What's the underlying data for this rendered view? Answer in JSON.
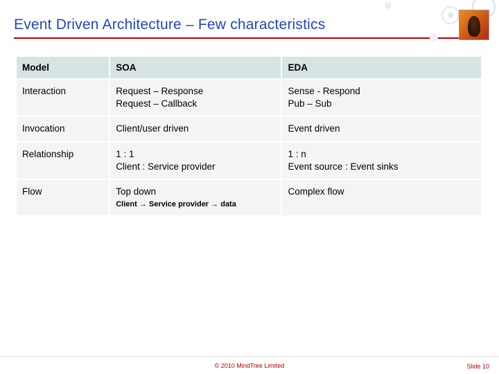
{
  "title": "Event Driven Architecture – Few characteristics",
  "table": {
    "headers": [
      "Model",
      "SOA",
      "EDA"
    ],
    "rows": [
      {
        "label": "Interaction",
        "soa": "Request – Response\nRequest – Callback",
        "eda": "Sense - Respond\nPub – Sub"
      },
      {
        "label": "Invocation",
        "soa": "Client/user driven",
        "eda": "Event driven"
      },
      {
        "label": "Relationship",
        "soa": "1 : 1\nClient : Service provider",
        "eda": "1 : n\nEvent source : Event sinks"
      },
      {
        "label": "Flow",
        "soa": "Top down",
        "soa_sub": "Client → Service provider → data",
        "eda": "Complex flow"
      }
    ]
  },
  "footer": {
    "copyright": "© 2010 MindTree Limited",
    "slide": "Slide 10"
  }
}
